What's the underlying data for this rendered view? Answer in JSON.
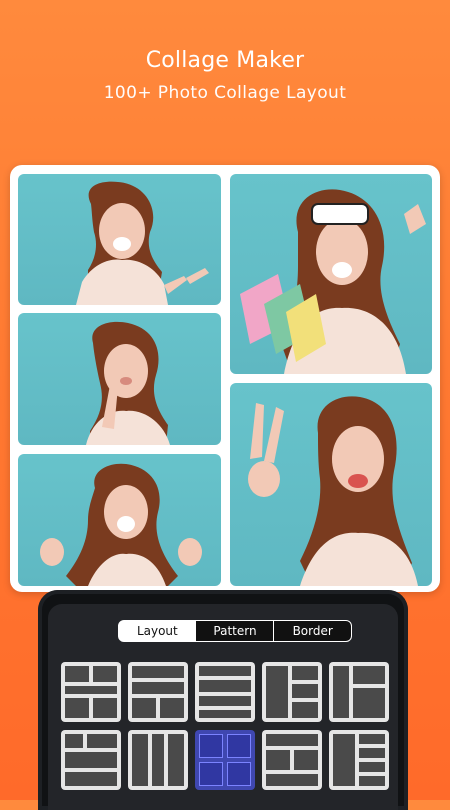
{
  "hero": {
    "title": "Collage Maker",
    "subtitle": "100+ Photo Collage Layout"
  },
  "colors": {
    "orange_top": "#ff8a3d",
    "orange_bottom": "#ff6a2a",
    "photo_bg": "#67c3cb",
    "selected_layout": "#3f47b0"
  },
  "collage": {
    "photos": [
      {
        "name": "photo-woman-pointing"
      },
      {
        "name": "photo-woman-thinking"
      },
      {
        "name": "photo-woman-cheering"
      },
      {
        "name": "photo-woman-shopping-bags-sunglasses"
      },
      {
        "name": "photo-woman-peace-sign-wink"
      }
    ]
  },
  "editor": {
    "tabs": [
      {
        "label": "Layout",
        "active": true
      },
      {
        "label": "Pattern",
        "active": false
      },
      {
        "label": "Border",
        "active": false
      }
    ],
    "selected_layout_index": 7
  }
}
